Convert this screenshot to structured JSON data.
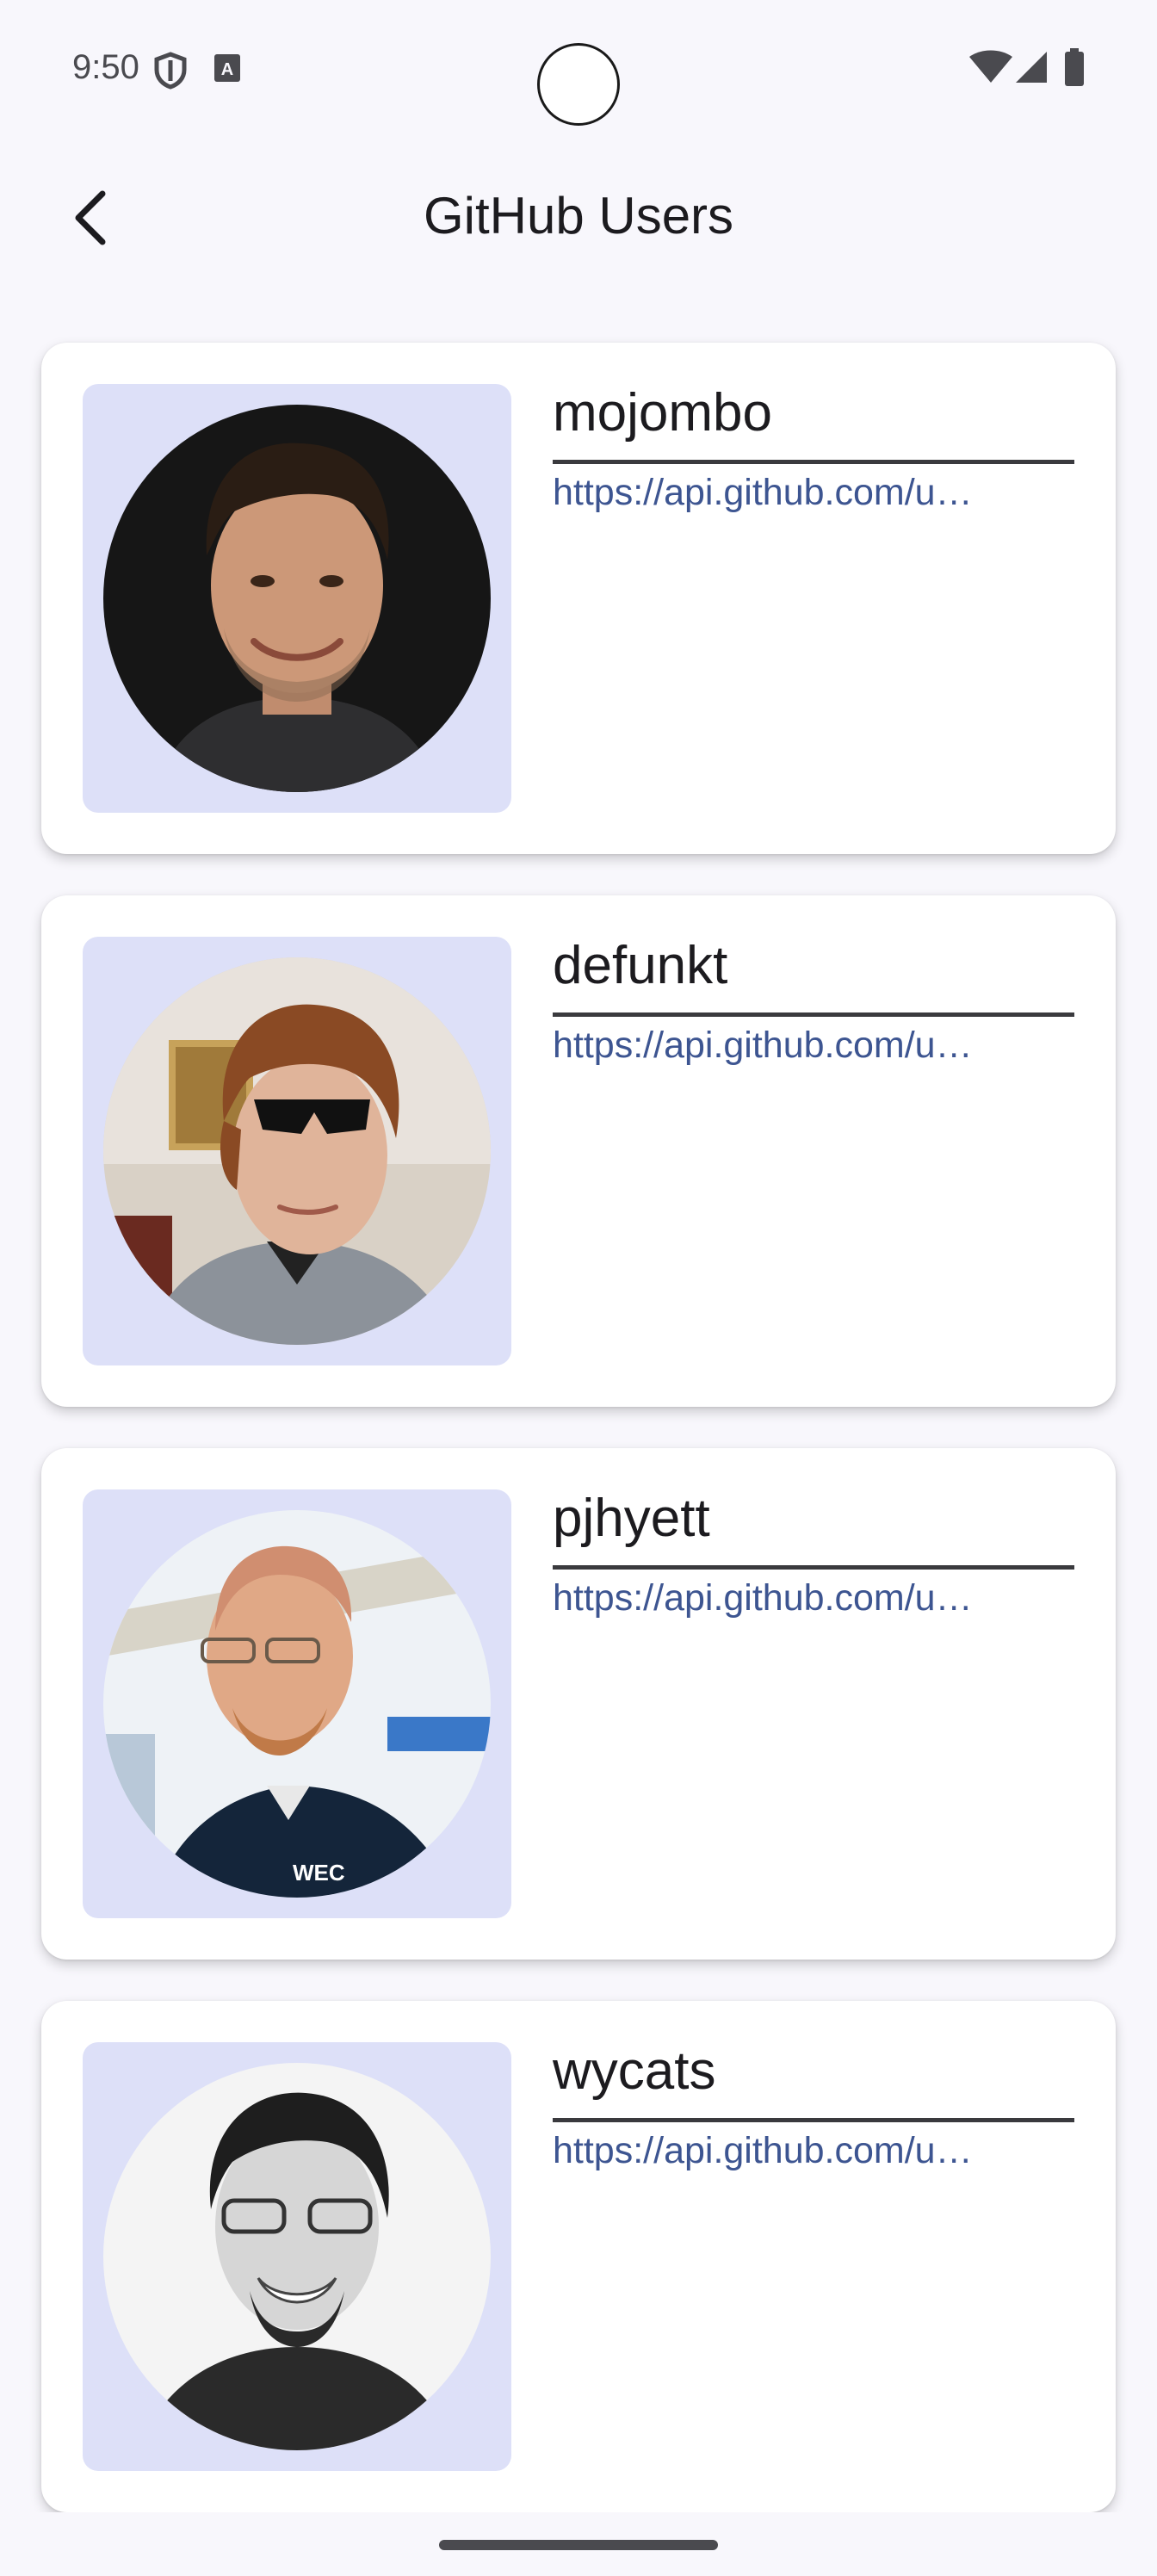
{
  "status_bar": {
    "time": "9:50",
    "icons": [
      "shield-icon",
      "a-notification-icon",
      "wifi-icon",
      "signal-icon",
      "battery-icon"
    ]
  },
  "app_bar": {
    "title": "GitHub Users",
    "back_icon": "back-arrow-icon"
  },
  "users": [
    {
      "login": "mojombo",
      "url": "https://api.github.com/u…"
    },
    {
      "login": "defunkt",
      "url": "https://api.github.com/u…"
    },
    {
      "login": "pjhyett",
      "url": "https://api.github.com/u…"
    },
    {
      "login": "wycats",
      "url": "https://api.github.com/u…"
    }
  ],
  "colors": {
    "background": "#f8f7fc",
    "card": "#ffffff",
    "avatar_tile": "#dde0f8",
    "url_text": "#3d5591",
    "title_text": "#1c1b1f"
  }
}
